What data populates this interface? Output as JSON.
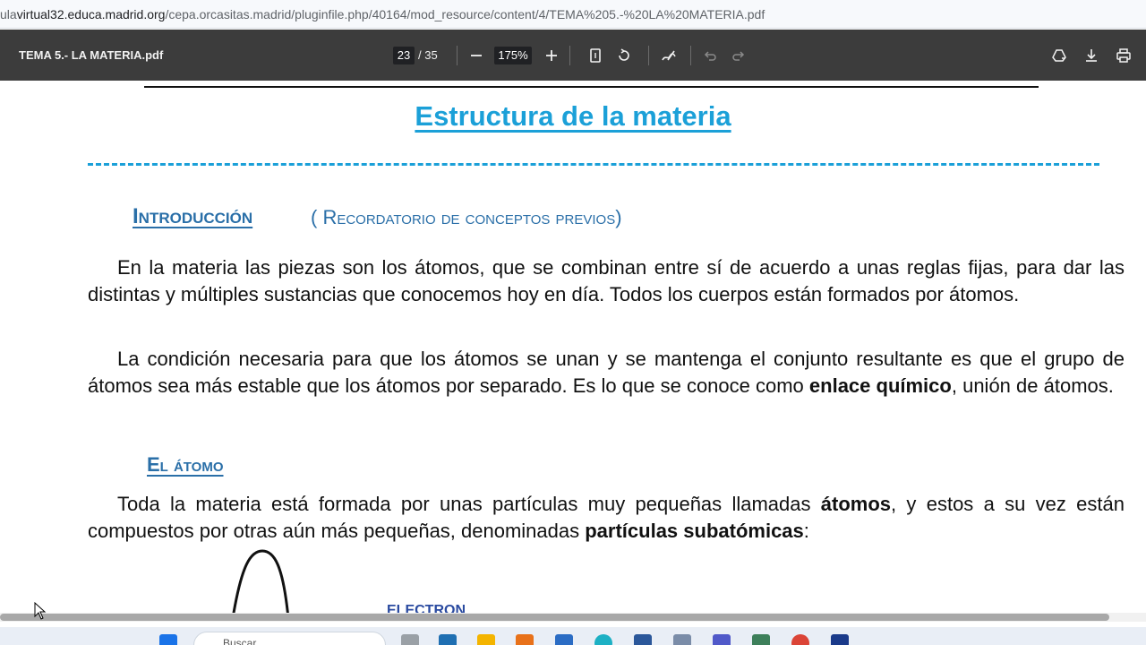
{
  "browser": {
    "url_prefix": "ula",
    "url_host": "virtual32.educa.madrid.org",
    "url_path": "/cepa.orcasitas.madrid/pluginfile.php/40164/mod_resource/content/4/TEMA%205.-%20LA%20MATERIA.pdf"
  },
  "pdf_toolbar": {
    "doc_title": "TEMA 5.- LA MATERIA.pdf",
    "page_current": "23",
    "page_total": "/ 35",
    "zoom": "175%",
    "icons": [
      "zoom-out-icon",
      "zoom-in-icon",
      "fit-page-icon",
      "rotate-icon",
      "annotate-icon",
      "undo-icon",
      "redo-icon",
      "drive-icon",
      "download-icon",
      "print-icon"
    ]
  },
  "document": {
    "title": "Estructura de la materia",
    "dashes": "----------------------------------------------------------------------------------------------------------",
    "intro_heading": "Introducción",
    "intro_subheading": "( Recordatorio de conceptos previos)",
    "p1": "En la materia las piezas son los átomos, que se combinan entre sí de acuerdo a unas reglas fijas, para dar las distintas y múltiples sustancias que conocemos hoy en día. Todos los cuerpos están formados por átomos.",
    "p2_a": "La condición necesaria para que los átomos se unan y se mantenga el conjunto resultante es que el grupo de átomos sea más estable que los átomos por separado. Es lo que se conoce como ",
    "p2_bold": "enlace químico",
    "p2_b": ", unión de átomos.",
    "atomo_heading": "El átomo",
    "p3_a": "Toda la materia está formada por unas partículas muy pequeñas llamadas ",
    "p3_bold1": "átomos",
    "p3_b": ", y estos a su vez están compuestos por otras aún más pequeñas, denominadas ",
    "p3_bold2": "partículas subatómicas",
    "p3_c": ":",
    "figure_label": "ELECTRON"
  },
  "taskbar": {
    "search_placeholder": "Buscar"
  }
}
